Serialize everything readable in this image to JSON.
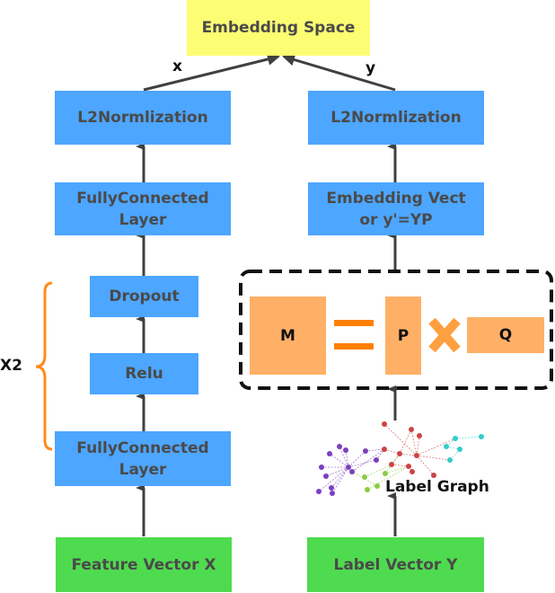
{
  "diagram": {
    "top": {
      "title": "Embedding Space"
    },
    "edge_labels": {
      "x": "x",
      "y": "y"
    },
    "left_branch": {
      "l2norm": "L2Normlization",
      "fc_top": "FullyConnected Layer",
      "dropout": "Dropout",
      "relu": "Relu",
      "fc_bottom": "FullyConnected Layer",
      "input": "Feature Vector X",
      "repeat_label": "X2"
    },
    "right_branch": {
      "l2norm": "L2Normlization",
      "embedding": "Embedding Vect or y'=YP",
      "factorization": {
        "m": "M",
        "p": "P",
        "q": "Q"
      },
      "graph_label": "Label Graph",
      "input": "Label Vector Y"
    },
    "colors": {
      "blue": "#4da6ff",
      "green": "#4fdb4f",
      "yellow": "#fdfd73",
      "orange": "#ffb066",
      "orange_dark": "#ff8000",
      "arrow": "#404040"
    }
  }
}
